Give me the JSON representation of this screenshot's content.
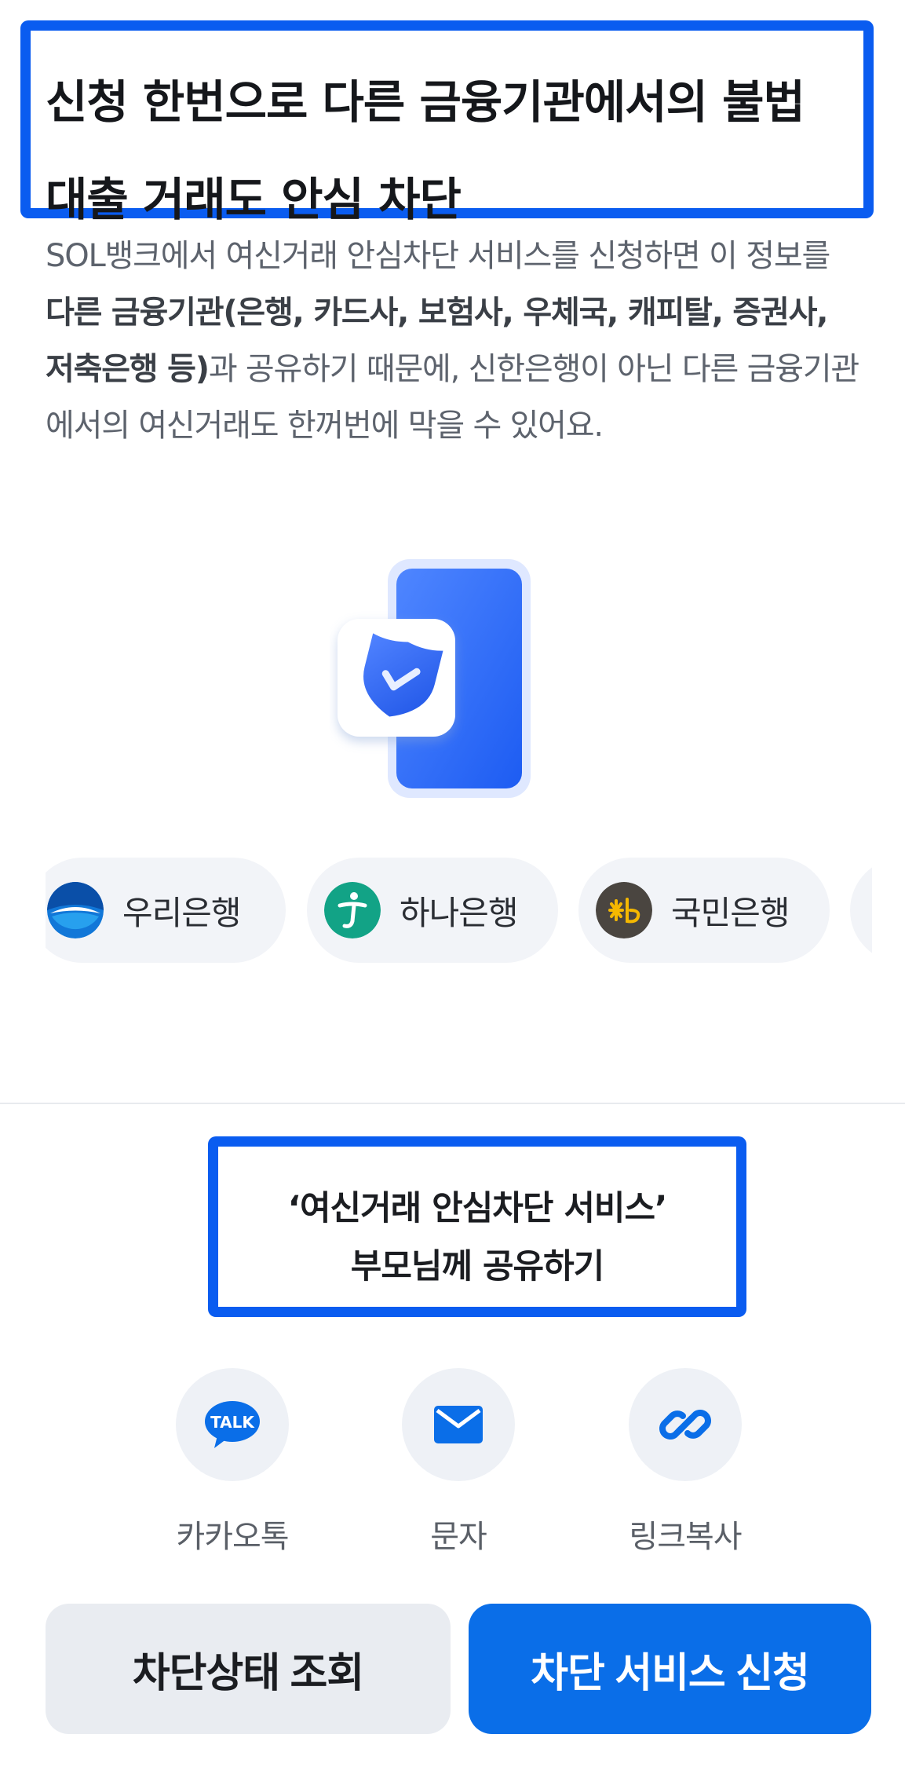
{
  "header": {
    "title_line1": "신청 한번으로 다른 금융기관에서의 불법",
    "title_line2": "대출 거래도 안심 차단"
  },
  "description": {
    "part1": "SOL뱅크에서 여신거래 안심차단 서비스를 신청하면 이 정보를 ",
    "bold": "다른 금융기관(은행, 카드사, 보험사, 우체국, 캐피탈, 증권사, 저축은행 등)",
    "part2": "과 공유하기 때문에, 신한은행이 아닌 다른 금융기관에서의 여신거래도 한꺼번에 막을 수 있어요."
  },
  "banks": [
    {
      "name": "우리은행",
      "icon": "woori-bank-logo",
      "color": "#0a64c8"
    },
    {
      "name": "하나은행",
      "icon": "hana-bank-logo",
      "color": "#12a386"
    },
    {
      "name": "국민은행",
      "icon": "kb-bank-logo",
      "color": "#4a4540"
    }
  ],
  "share": {
    "title_line1": "‘여신거래 안심차단 서비스’",
    "title_line2": "부모님께 공유하기",
    "options": [
      {
        "label": "카카오톡",
        "icon": "kakaotalk-icon",
        "badge": "TALK"
      },
      {
        "label": "문자",
        "icon": "message-icon"
      },
      {
        "label": "링크복사",
        "icon": "link-icon"
      }
    ]
  },
  "buttons": {
    "status": "차단상태 조회",
    "apply": "차단 서비스 신청"
  },
  "colors": {
    "accent": "#0a6ee8",
    "highlight_border": "#0a5cf0"
  }
}
